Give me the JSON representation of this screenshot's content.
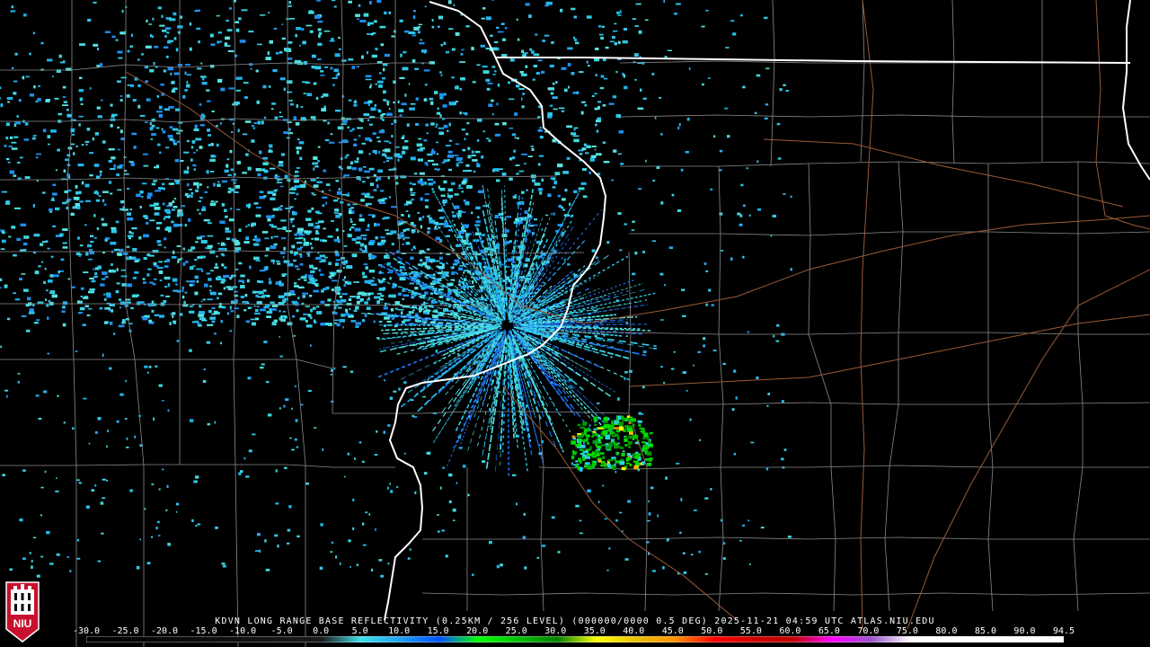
{
  "product": {
    "caption": "KDVN LONG RANGE BASE REFLECTIVITY (0.25KM / 256 LEVEL) (000000/0000 0.5 DEG) 2025-11-21 04:59 UTC  ATLAS.NIU.EDU"
  },
  "logo": {
    "text": "NIU",
    "colors": {
      "red": "#c8102e",
      "white": "#ffffff",
      "black": "#000000"
    }
  },
  "colors": {
    "background": "#000000",
    "county_lines": "#8a8a8a",
    "state_lines": "#ffffff",
    "highways": "#9a5a38"
  },
  "colorbar": {
    "ticks": [
      "-30.0",
      "-25.0",
      "-20.0",
      "-15.0",
      "-10.0",
      "-5.0",
      "0.0",
      "5.0",
      "10.0",
      "15.0",
      "20.0",
      "25.0",
      "30.0",
      "35.0",
      "40.0",
      "45.0",
      "50.0",
      "55.0",
      "60.0",
      "65.0",
      "70.0",
      "75.0",
      "80.0",
      "85.0",
      "90.0",
      "94.5"
    ],
    "stops": [
      {
        "dbz": -30,
        "color": "#000000"
      },
      {
        "dbz": 0,
        "color": "#1a1a1a"
      },
      {
        "dbz": 5,
        "color": "#40e0e8"
      },
      {
        "dbz": 10,
        "color": "#1ea0f0"
      },
      {
        "dbz": 15,
        "color": "#0050ff"
      },
      {
        "dbz": 20,
        "color": "#00ff00"
      },
      {
        "dbz": 25,
        "color": "#00c000"
      },
      {
        "dbz": 30,
        "color": "#008000"
      },
      {
        "dbz": 35,
        "color": "#ffff00"
      },
      {
        "dbz": 40,
        "color": "#e8c000"
      },
      {
        "dbz": 45,
        "color": "#ff9000"
      },
      {
        "dbz": 50,
        "color": "#ff0000"
      },
      {
        "dbz": 55,
        "color": "#d00000"
      },
      {
        "dbz": 60,
        "color": "#c00000"
      },
      {
        "dbz": 65,
        "color": "#ff00ff"
      },
      {
        "dbz": 70,
        "color": "#9955c9"
      },
      {
        "dbz": 75,
        "color": "#ffffff"
      },
      {
        "dbz": 94.5,
        "color": "#ffffff"
      }
    ]
  },
  "map_layers": [
    "county-borders",
    "state-borders",
    "highways",
    "radar-echoes"
  ]
}
